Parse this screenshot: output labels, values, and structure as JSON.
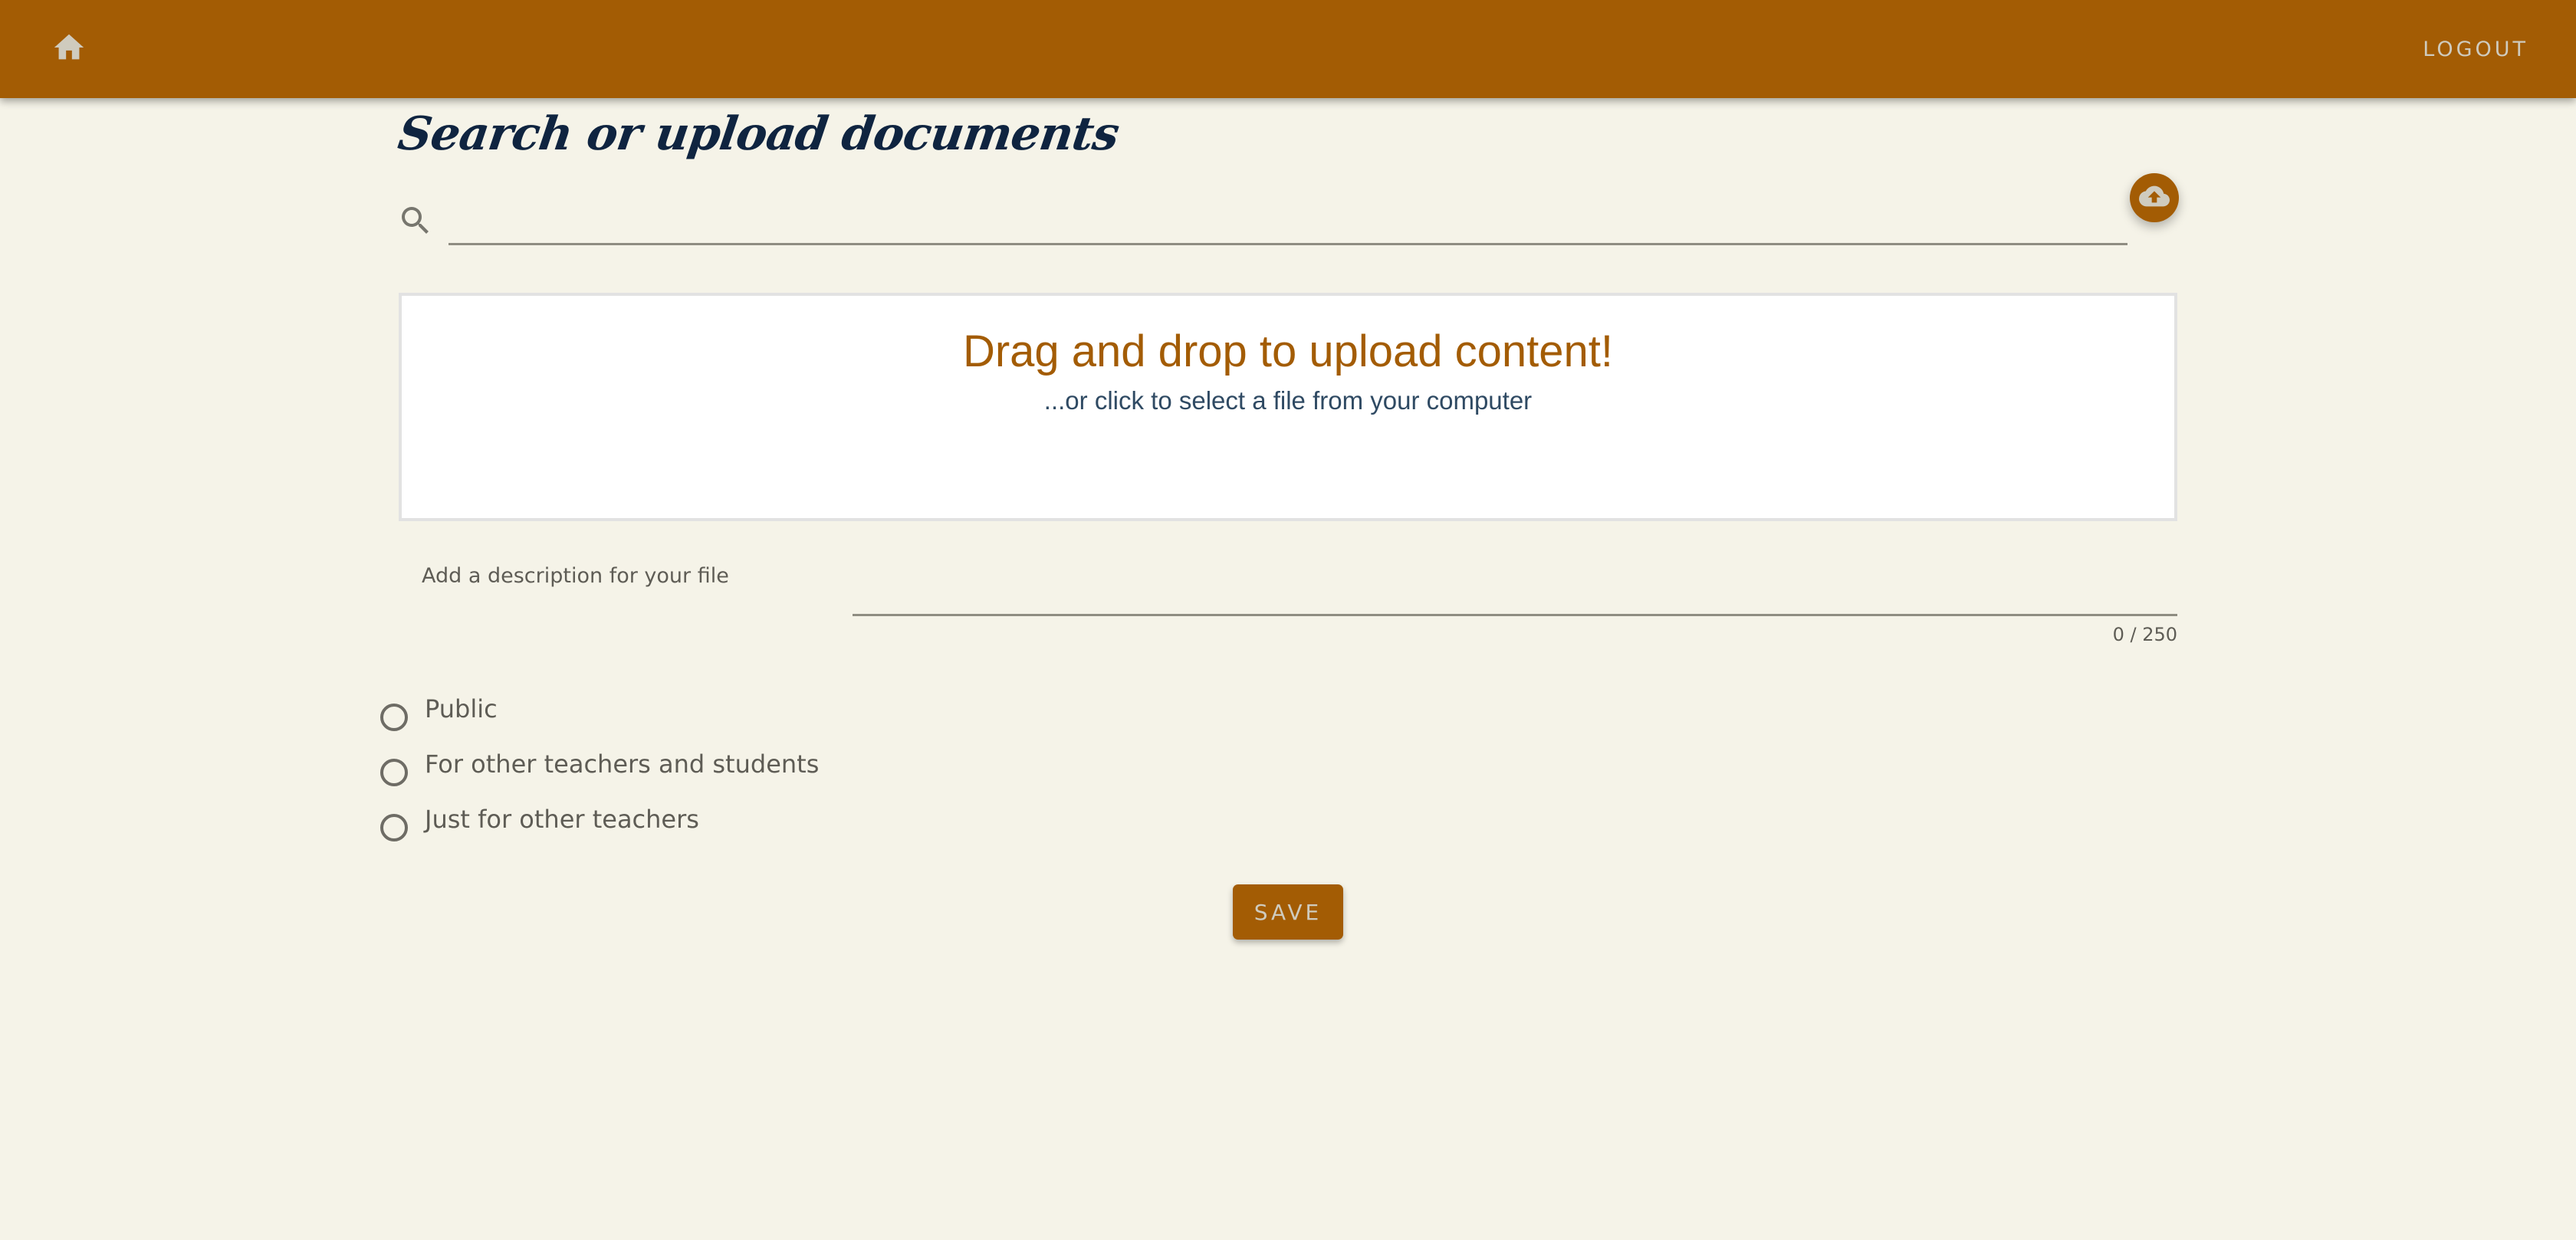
{
  "appbar": {
    "home_icon": "home-icon",
    "logout_label": "LOGOUT",
    "color": "#A35C04"
  },
  "page": {
    "title": "Search or upload documents"
  },
  "search": {
    "icon": "search-icon",
    "value": "",
    "placeholder": ""
  },
  "upload_fab": {
    "icon": "cloud-upload-icon"
  },
  "dropzone": {
    "title": "Drag and drop to upload content!",
    "subtitle": "...or click to select a file from your computer"
  },
  "description": {
    "label": "Add a description for your file",
    "value": "",
    "counter": "0 / 250"
  },
  "visibility": {
    "options": [
      {
        "label": "Public",
        "selected": false
      },
      {
        "label": "For other teachers and students",
        "selected": false
      },
      {
        "label": "Just for other teachers",
        "selected": false
      }
    ]
  },
  "actions": {
    "save_label": "SAVE"
  },
  "colors": {
    "primary": "#A35C04",
    "background": "#F5F3E8",
    "title": "#0F2440",
    "muted_text": "#5E5C55",
    "on_primary": "#CFCBBE"
  }
}
